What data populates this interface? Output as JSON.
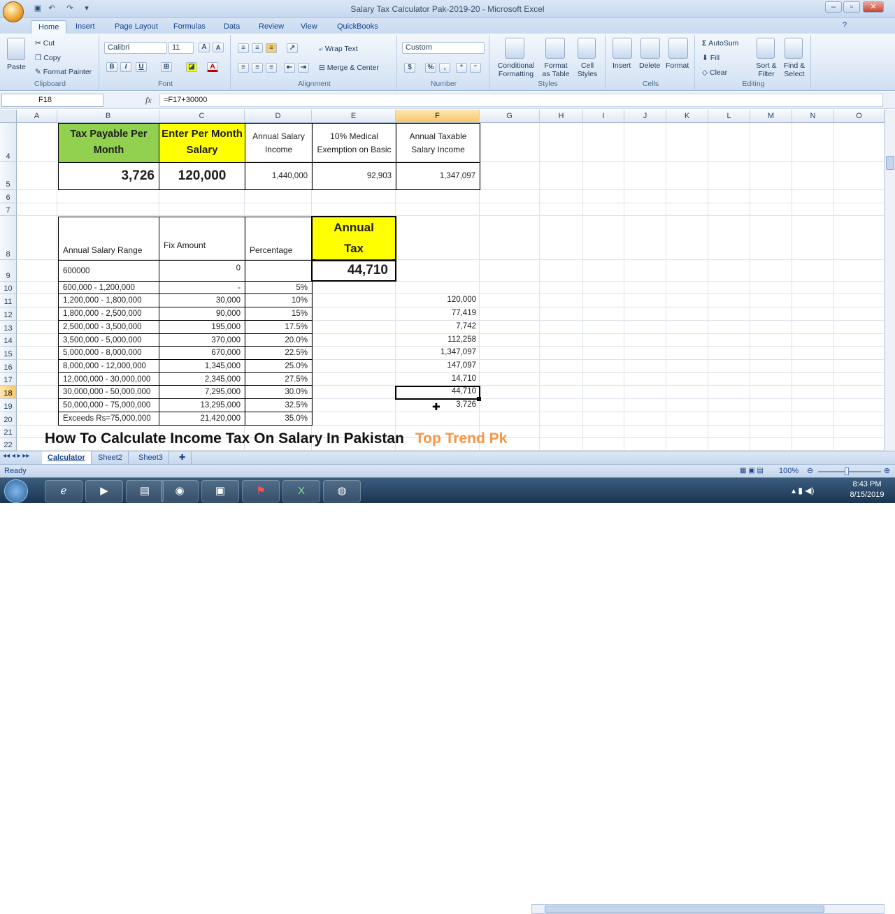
{
  "window": {
    "title": "Salary Tax Calculator Pak-2019-20 - Microsoft Excel"
  },
  "tabs": [
    "Home",
    "Insert",
    "Page Layout",
    "Formulas",
    "Data",
    "Review",
    "View",
    "QuickBooks"
  ],
  "ribbon": {
    "clipboard": {
      "label": "Clipboard",
      "paste": "Paste",
      "cut": "Cut",
      "copy": "Copy",
      "format_painter": "Format Painter"
    },
    "font": {
      "label": "Font",
      "name": "Calibri",
      "size": "11",
      "bold": "B",
      "italic": "I",
      "underline": "U"
    },
    "alignment": {
      "label": "Alignment",
      "wrap": "Wrap Text",
      "merge": "Merge & Center"
    },
    "number": {
      "label": "Number",
      "format": "Custom",
      "currency": "$",
      "percent": "%",
      "comma": ","
    },
    "styles": {
      "label": "Styles",
      "cond": "Conditional",
      "cond2": "Formatting",
      "fmt_table": "Format",
      "fmt_table2": "as Table",
      "cell": "Cell",
      "cell2": "Styles"
    },
    "cells": {
      "label": "Cells",
      "insert": "Insert",
      "delete": "Delete",
      "format": "Format"
    },
    "editing": {
      "label": "Editing",
      "autosum": "AutoSum",
      "fill": "Fill",
      "clear": "Clear",
      "sort": "Sort &",
      "sort2": "Filter",
      "find": "Find &",
      "find2": "Select"
    }
  },
  "formula_bar": {
    "name_box": "F18",
    "fx": "fx",
    "formula": "=F17+30000"
  },
  "columns": [
    "A",
    "B",
    "C",
    "D",
    "E",
    "F",
    "G",
    "H",
    "I",
    "J",
    "K",
    "L",
    "M",
    "N",
    "O"
  ],
  "rows": [
    "4",
    "5",
    "6",
    "7",
    "8",
    "9",
    "10",
    "11",
    "12",
    "13",
    "14",
    "15",
    "16",
    "17",
    "18",
    "19",
    "20",
    "21",
    "22"
  ],
  "cells": {
    "b4": "Tax Payable Per Month",
    "c4": "Enter Per Month Salary",
    "d4": "Annual Salary Income",
    "e4": "10% Medical Exemption on Basic",
    "f4": "Annual Taxable Salary Income",
    "b5": "3,726",
    "c5": "120,000",
    "d5": "1,440,000",
    "e5": "92,903",
    "f5": "1,347,097",
    "b8": "Annual Salary Range",
    "c8": "Fix Amount",
    "d8": "Percentage",
    "e8a": "Annual",
    "e8b": "Tax",
    "b9": "600000",
    "c9": "0",
    "e9": "44,710"
  },
  "slabs": [
    {
      "range": "600,000 - 1,200,000",
      "fix": "-",
      "pct": "5%",
      "f": ""
    },
    {
      "range": "1,200,000 - 1,800,000",
      "fix": "30,000",
      "pct": "10%",
      "f": "120,000"
    },
    {
      "range": "1,800,000 - 2,500,000",
      "fix": "90,000",
      "pct": "15%",
      "f": "77,419"
    },
    {
      "range": "2,500,000 - 3,500,000",
      "fix": "195,000",
      "pct": "17.5%",
      "f": "7,742"
    },
    {
      "range": "3,500,000 - 5,000,000",
      "fix": "370,000",
      "pct": "20.0%",
      "f": "112,258"
    },
    {
      "range": "5,000,000 - 8,000,000",
      "fix": "670,000",
      "pct": "22.5%",
      "f": "1,347,097"
    },
    {
      "range": "8,000,000 - 12,000,000",
      "fix": "1,345,000",
      "pct": "25.0%",
      "f": "147,097"
    },
    {
      "range": "12,000,000 - 30,000,000",
      "fix": "2,345,000",
      "pct": "27.5%",
      "f": "14,710"
    },
    {
      "range": "30,000,000 - 50,000,000",
      "fix": "7,295,000",
      "pct": "30.0%",
      "f": "44,710"
    },
    {
      "range": "50,000,000 - 75,000,000",
      "fix": "13,295,000",
      "pct": "32.5%",
      "f": "3,726"
    },
    {
      "range": "Exceeds Rs=75,000,000",
      "fix": "21,420,000",
      "pct": "35.0%",
      "f": ""
    }
  ],
  "overlay": {
    "caption": "How To Calculate Income Tax On Salary In Pakistan",
    "brand": "Top Trend Pk"
  },
  "sheets": [
    "Calculator",
    "Sheet2",
    "Sheet3"
  ],
  "status": {
    "ready": "Ready",
    "zoom": "100%"
  },
  "clock": {
    "time": "8:43 PM",
    "date": "8/15/2019"
  },
  "colors": {
    "green": "#92d050",
    "yellow": "#ffff00",
    "brand": "#f79646"
  }
}
